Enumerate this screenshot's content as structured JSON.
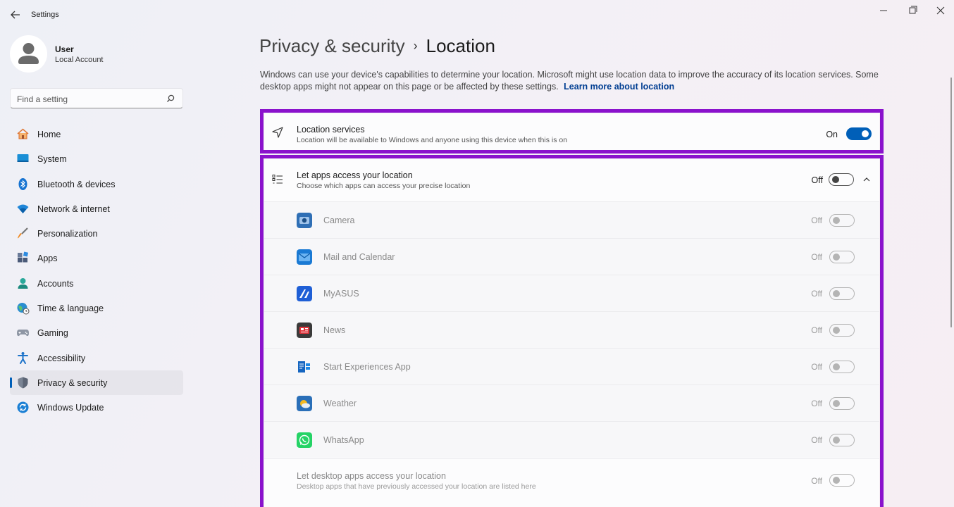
{
  "window": {
    "title": "Settings",
    "icons": {
      "back": "back-arrow-icon",
      "minimize": "minimize-icon",
      "maximize": "restore-icon",
      "close": "close-icon"
    }
  },
  "profile": {
    "name": "User",
    "account_type": "Local Account"
  },
  "search": {
    "placeholder": "Find a setting"
  },
  "sidebar": {
    "items": [
      {
        "label": "Home",
        "icon": "home-icon"
      },
      {
        "label": "System",
        "icon": "system-icon"
      },
      {
        "label": "Bluetooth & devices",
        "icon": "bluetooth-icon"
      },
      {
        "label": "Network & internet",
        "icon": "wifi-icon"
      },
      {
        "label": "Personalization",
        "icon": "brush-icon"
      },
      {
        "label": "Apps",
        "icon": "apps-icon"
      },
      {
        "label": "Accounts",
        "icon": "accounts-icon"
      },
      {
        "label": "Time & language",
        "icon": "globe-clock-icon"
      },
      {
        "label": "Gaming",
        "icon": "gamepad-icon"
      },
      {
        "label": "Accessibility",
        "icon": "accessibility-icon"
      },
      {
        "label": "Privacy & security",
        "icon": "shield-icon",
        "active": true
      },
      {
        "label": "Windows Update",
        "icon": "update-icon"
      }
    ]
  },
  "header": {
    "parent": "Privacy & security",
    "separator": "›",
    "current": "Location"
  },
  "description": {
    "text": "Windows can use your device's capabilities to determine your location. Microsoft might use location data to improve the accuracy of its location services. Some desktop apps might not appear on this page or be affected by these settings.",
    "link": "Learn more about location"
  },
  "location_services": {
    "title": "Location services",
    "subtitle": "Location will be available to Windows and anyone using this device when this is on",
    "state": "On",
    "icon": "location-arrow-icon"
  },
  "app_access": {
    "title": "Let apps access your location",
    "subtitle": "Choose which apps can access your precise location",
    "state": "Off",
    "icon": "list-icon",
    "expand_icon": "chevron-up-icon",
    "apps": [
      {
        "name": "Camera",
        "state": "Off",
        "icon": "camera-app-icon",
        "color": "#2f6fb5"
      },
      {
        "name": "Mail and Calendar",
        "state": "Off",
        "icon": "mail-app-icon",
        "color": "#1a7ad4"
      },
      {
        "name": "MyASUS",
        "state": "Off",
        "icon": "myasus-app-icon",
        "color": "#1f5fd6"
      },
      {
        "name": "News",
        "state": "Off",
        "icon": "news-app-icon",
        "color": "#3a3a3a"
      },
      {
        "name": "Start Experiences App",
        "state": "Off",
        "icon": "start-experiences-app-icon",
        "color": "#1565c0"
      },
      {
        "name": "Weather",
        "state": "Off",
        "icon": "weather-app-icon",
        "color": "#2a6fb8"
      },
      {
        "name": "WhatsApp",
        "state": "Off",
        "icon": "whatsapp-app-icon",
        "color": "#25d366"
      }
    ],
    "desktop_apps": {
      "title": "Let desktop apps access your location",
      "subtitle": "Desktop apps that have previously accessed your location are listed here",
      "state": "Off"
    }
  },
  "colors": {
    "accent": "#005fb8",
    "highlight_box": "#8a12cc",
    "link": "#003e92"
  }
}
